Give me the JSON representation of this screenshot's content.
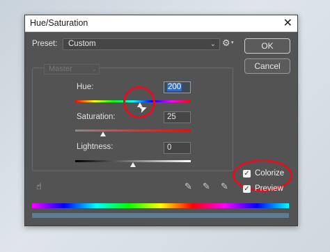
{
  "window": {
    "title": "Hue/Saturation",
    "close_glyph": "✕"
  },
  "preset": {
    "label": "Preset:",
    "value": "Custom"
  },
  "buttons": {
    "ok": "OK",
    "cancel": "Cancel"
  },
  "channel": {
    "value": "Master"
  },
  "adjustments": {
    "hue": {
      "label": "Hue:",
      "value": "200"
    },
    "saturation": {
      "label": "Saturation:",
      "value": "25"
    },
    "lightness": {
      "label": "Lightness:",
      "value": "0"
    }
  },
  "options": {
    "colorize": {
      "label": "Colorize",
      "checked": true
    },
    "preview": {
      "label": "Preview",
      "checked": true
    }
  },
  "icons": {
    "gear": "gear-icon",
    "hand": "hand-adjust-icon",
    "eyedropper": "eyedropper-icon",
    "eyedropper_plus": "eyedropper-plus-icon",
    "eyedropper_minus": "eyedropper-minus-icon"
  },
  "colors": {
    "dialog_bg": "#535353",
    "highlight_ring": "#e01020",
    "input_focus": "#6ea8e0"
  }
}
